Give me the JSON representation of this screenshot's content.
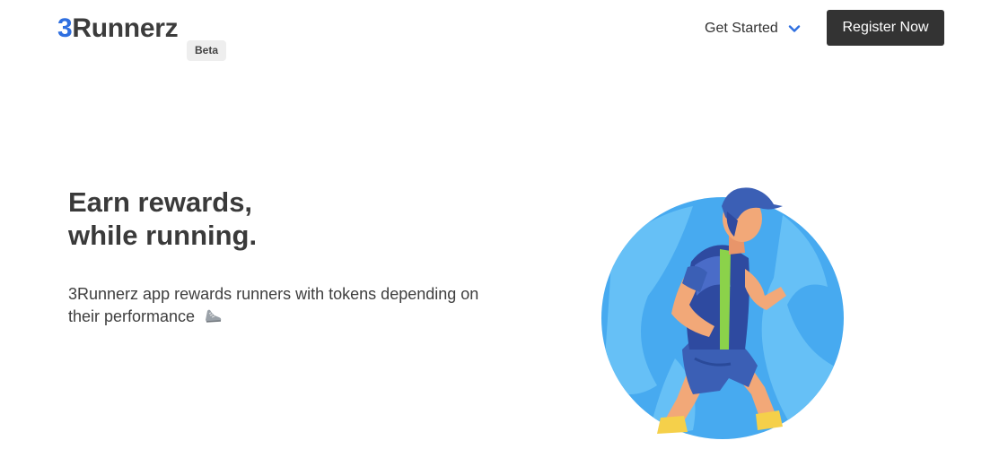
{
  "header": {
    "logo_prefix": "3",
    "logo_rest": "Runnerz",
    "beta_badge": "Beta",
    "nav_dropdown_label": "Get Started",
    "register_label": "Register Now"
  },
  "hero": {
    "title_line1": "Earn rewards,",
    "title_line2": "while running.",
    "description": "3Runnerz app rewards runners with tokens depending on their performance"
  },
  "icons": {
    "dropdown": "chevron-down-icon",
    "shoe": "running-shoe-icon",
    "illustration": "runner-illustration"
  },
  "colors": {
    "brand_blue": "#2f6fe0",
    "button_dark": "#333333",
    "circle_blue": "#47aaf0"
  }
}
